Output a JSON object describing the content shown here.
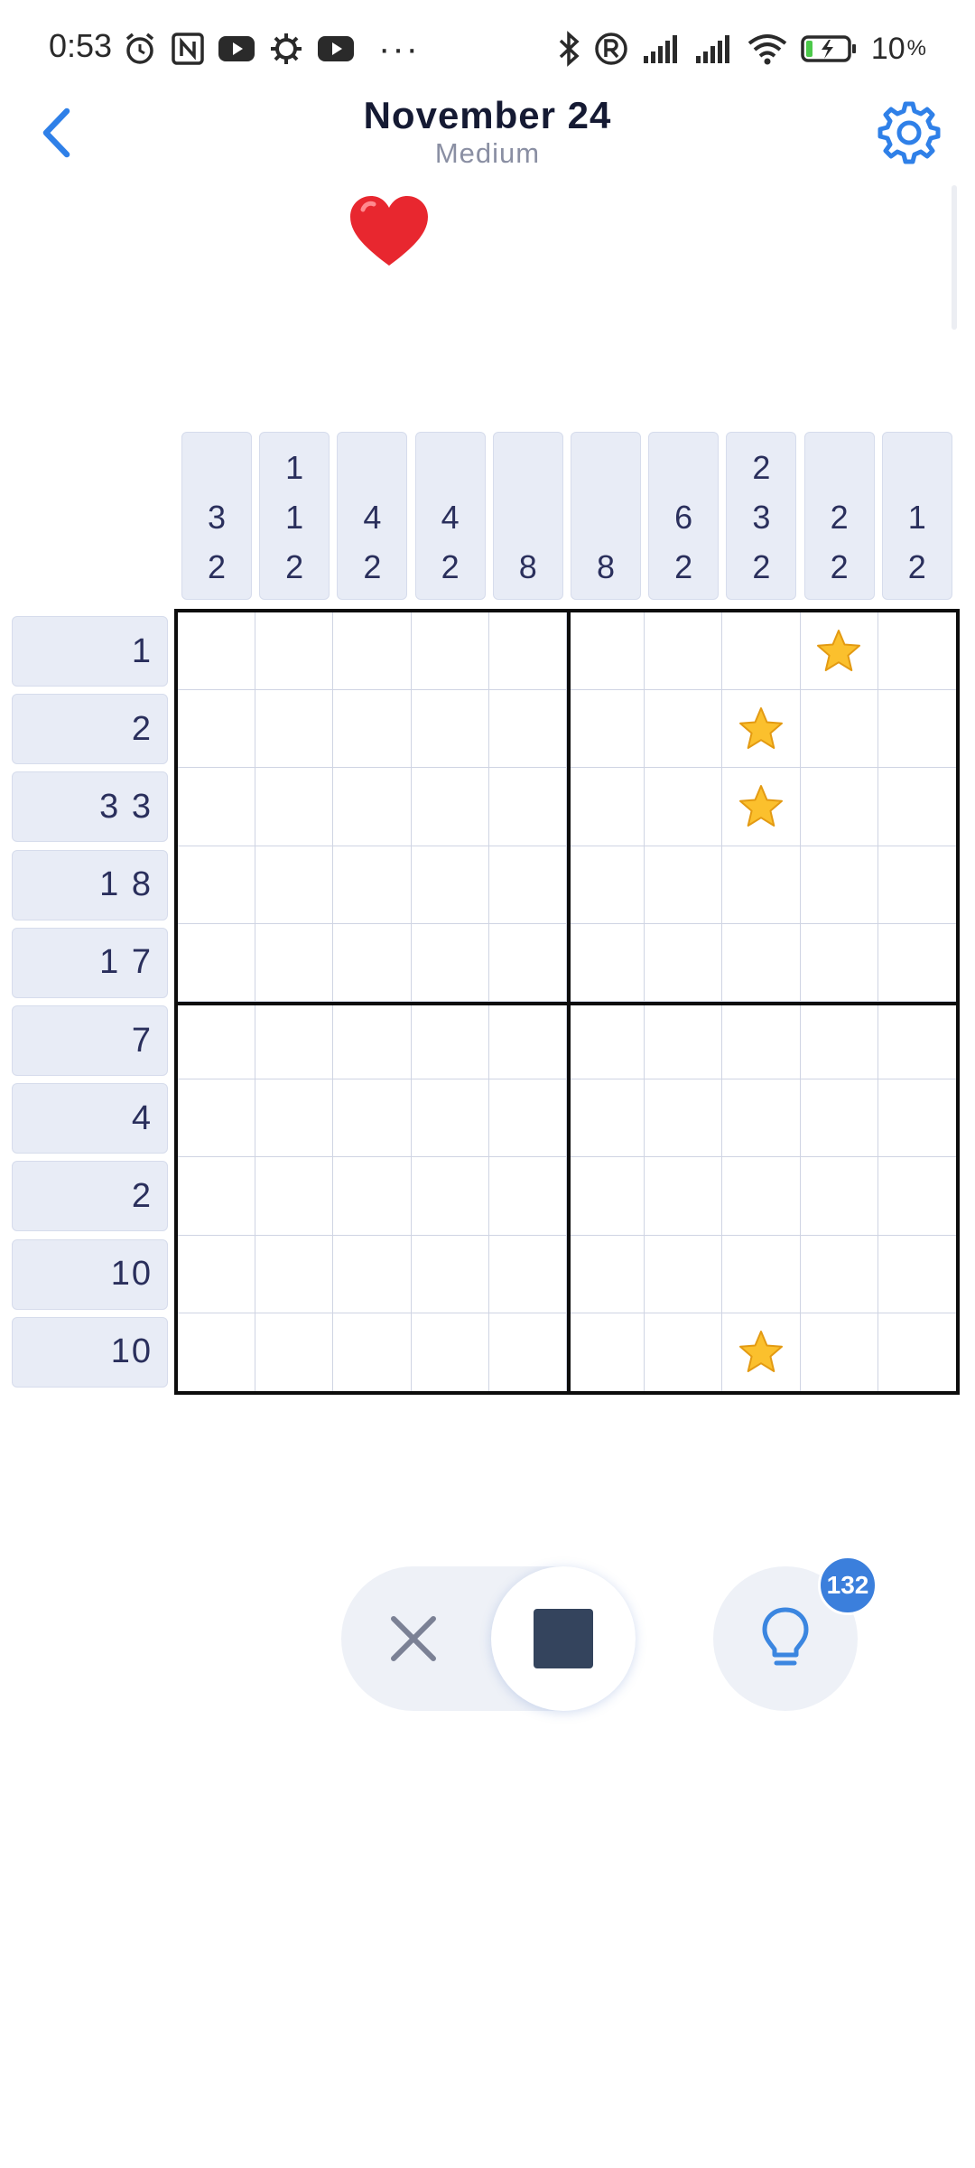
{
  "status_bar": {
    "time": "0:53",
    "dots": "···",
    "battery_percent": "10",
    "left_icons": [
      "alarm-icon",
      "nfc-icon",
      "youtube-icon",
      "gear-notification-icon",
      "youtube-icon"
    ],
    "right_icons": [
      "bluetooth-icon",
      "registered-icon",
      "signal-icon",
      "signal-icon",
      "wifi-icon",
      "battery-charging-icon"
    ]
  },
  "header": {
    "title": "November 24",
    "difficulty": "Medium",
    "back_icon": "chevron-left-icon",
    "settings_icon": "gear-icon",
    "accent_color": "#2f80e8"
  },
  "lives": {
    "icon": "heart-icon",
    "color": "#e8272f",
    "count": 1
  },
  "puzzle": {
    "size": 10,
    "column_clues": [
      [
        "3",
        "2"
      ],
      [
        "1",
        "1",
        "2"
      ],
      [
        "4",
        "2"
      ],
      [
        "4",
        "2"
      ],
      [
        "8"
      ],
      [
        "8"
      ],
      [
        "6",
        "2"
      ],
      [
        "2",
        "3",
        "2"
      ],
      [
        "2",
        "2"
      ],
      [
        "1",
        "2"
      ]
    ],
    "row_clues": [
      "1",
      "2",
      "3 3",
      "1 8",
      "1 7",
      "7",
      "4",
      "2",
      "10",
      "10"
    ],
    "star_cells": [
      {
        "row": 0,
        "col": 8
      },
      {
        "row": 1,
        "col": 7
      },
      {
        "row": 2,
        "col": 7
      },
      {
        "row": 9,
        "col": 7
      }
    ],
    "star_icon": "star-icon"
  },
  "controls": {
    "mode_cross_icon": "cross-icon",
    "mode_fill_icon": "filled-square-icon",
    "active_mode": "fill",
    "hint_icon": "lightbulb-icon",
    "hint_count": "132"
  }
}
